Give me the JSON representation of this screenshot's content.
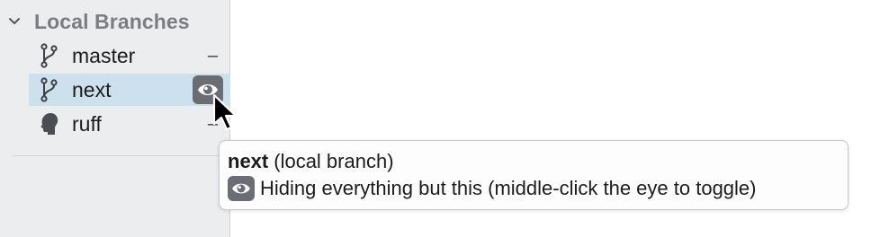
{
  "sidebar": {
    "section": {
      "title": "Local Branches",
      "expanded": true
    },
    "branches": [
      {
        "label": "master",
        "icon": "branch-icon",
        "action": "–",
        "selected": false
      },
      {
        "label": "next",
        "icon": "branch-icon",
        "action_icon": "eye-icon",
        "selected": true
      },
      {
        "label": "ruff",
        "icon": "head-icon",
        "action": "–",
        "selected": false
      }
    ]
  },
  "tooltip": {
    "branch_name": "next",
    "branch_kind": "(local branch)",
    "icon": "eye-icon",
    "hint": "Hiding everything but this (middle-click the eye to toggle)"
  },
  "colors": {
    "sidebar_bg": "#ecedef",
    "selection_bg": "#cde0ee",
    "eye_button_bg": "#6a6e74",
    "header_text": "#7a7d82"
  }
}
